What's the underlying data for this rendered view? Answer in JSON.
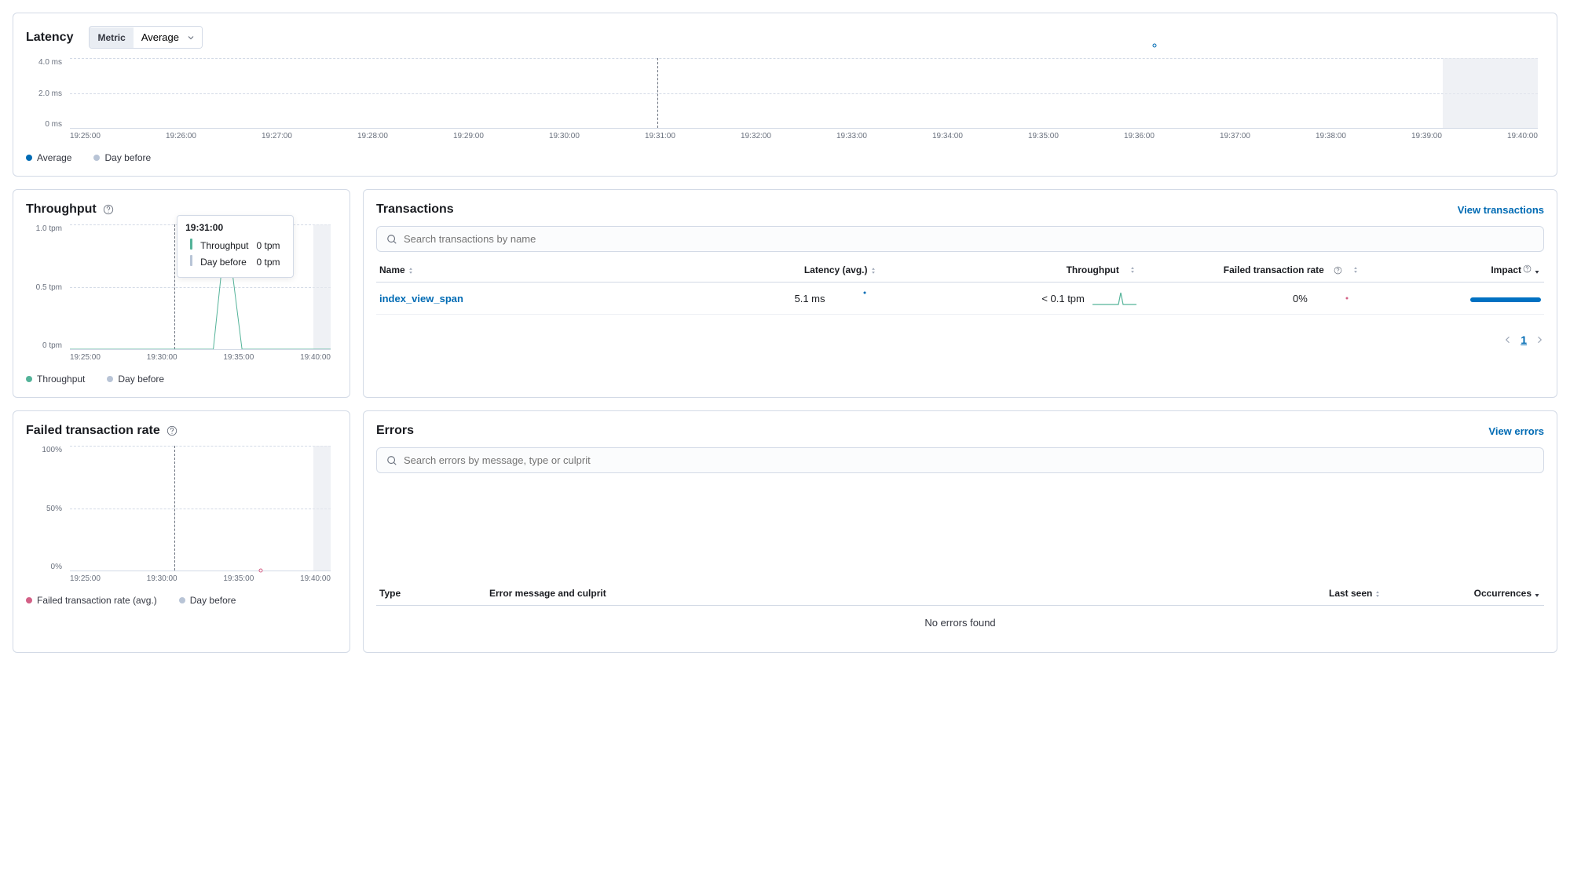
{
  "latency_panel": {
    "title": "Latency",
    "metric_label": "Metric",
    "metric_value": "Average",
    "y_ticks": [
      "4.0 ms",
      "2.0 ms",
      "0 ms"
    ],
    "x_ticks": [
      "19:25:00",
      "19:26:00",
      "19:27:00",
      "19:28:00",
      "19:29:00",
      "19:30:00",
      "19:31:00",
      "19:32:00",
      "19:33:00",
      "19:34:00",
      "19:35:00",
      "19:36:00",
      "19:37:00",
      "19:38:00",
      "19:39:00",
      "19:40:00"
    ],
    "legend": [
      {
        "label": "Average",
        "color": "#006bb4"
      },
      {
        "label": "Day before",
        "color": "#b8c4d6"
      }
    ],
    "data_point_x_pct": 73.9,
    "cursor_x_pct": 40.0,
    "ghost_start_pct": 93.5,
    "ghost_end_pct": 100
  },
  "throughput_panel": {
    "title": "Throughput",
    "y_ticks": [
      "1.0 tpm",
      "0.5 tpm",
      "0 tpm"
    ],
    "x_ticks": [
      "19:25:00",
      "19:30:00",
      "19:35:00",
      "19:40:00"
    ],
    "legend": [
      {
        "label": "Throughput",
        "color": "#54b399"
      },
      {
        "label": "Day before",
        "color": "#b8c4d6"
      }
    ],
    "cursor_x_pct": 40.0,
    "ghost_start_pct": 93.5,
    "tooltip": {
      "time": "19:31:00",
      "rows": [
        {
          "label": "Throughput",
          "value": "0 tpm",
          "color": "#54b399"
        },
        {
          "label": "Day before",
          "value": "0 tpm",
          "color": "#b8c4d6"
        }
      ]
    }
  },
  "failed_panel": {
    "title": "Failed transaction rate",
    "y_ticks": [
      "100%",
      "50%",
      "0%"
    ],
    "x_ticks": [
      "19:25:00",
      "19:30:00",
      "19:35:00",
      "19:40:00"
    ],
    "legend": [
      {
        "label": "Failed transaction rate (avg.)",
        "color": "#d36086"
      },
      {
        "label": "Day before",
        "color": "#b8c4d6"
      }
    ],
    "cursor_x_pct": 40.0,
    "ghost_start_pct": 93.5,
    "data_point_x_pct": 73.3
  },
  "transactions_panel": {
    "title": "Transactions",
    "view_link": "View transactions",
    "search_placeholder": "Search transactions by name",
    "columns": {
      "name": "Name",
      "latency": "Latency (avg.)",
      "throughput": "Throughput",
      "failed": "Failed transaction rate",
      "impact": "Impact"
    },
    "rows": [
      {
        "name": "index_view_span",
        "latency": "5.1 ms",
        "throughput": "< 0.1 tpm",
        "failed": "0%"
      }
    ],
    "page": "1"
  },
  "errors_panel": {
    "title": "Errors",
    "view_link": "View errors",
    "search_placeholder": "Search errors by message, type or culprit",
    "columns": {
      "type": "Type",
      "message": "Error message and culprit",
      "last_seen": "Last seen",
      "occurrences": "Occurrences"
    },
    "empty": "No errors found"
  },
  "chart_data": [
    {
      "type": "line",
      "title": "Latency",
      "ylabel": "ms",
      "ylim": [
        0,
        4.0
      ],
      "x": [
        "19:25:00",
        "19:26:00",
        "19:27:00",
        "19:28:00",
        "19:29:00",
        "19:30:00",
        "19:31:00",
        "19:32:00",
        "19:33:00",
        "19:34:00",
        "19:35:00",
        "19:36:00",
        "19:37:00",
        "19:38:00",
        "19:39:00",
        "19:40:00"
      ],
      "series": [
        {
          "name": "Average",
          "values": [
            null,
            null,
            null,
            null,
            null,
            null,
            null,
            null,
            null,
            null,
            null,
            5.1,
            null,
            null,
            null,
            null
          ]
        },
        {
          "name": "Day before",
          "values": [
            null,
            null,
            null,
            null,
            null,
            null,
            null,
            null,
            null,
            null,
            null,
            null,
            null,
            null,
            null,
            null
          ]
        }
      ]
    },
    {
      "type": "line",
      "title": "Throughput",
      "ylabel": "tpm",
      "ylim": [
        0,
        1.0
      ],
      "x": [
        "19:25:00",
        "19:26:00",
        "19:27:00",
        "19:28:00",
        "19:29:00",
        "19:30:00",
        "19:31:00",
        "19:32:00",
        "19:33:00",
        "19:34:00",
        "19:35:00",
        "19:36:00",
        "19:37:00",
        "19:38:00",
        "19:39:00",
        "19:40:00"
      ],
      "series": [
        {
          "name": "Throughput",
          "values": [
            0,
            0,
            0,
            0,
            0,
            0,
            0,
            0,
            0,
            1.0,
            0,
            0,
            0,
            0,
            0,
            0
          ]
        },
        {
          "name": "Day before",
          "values": [
            0,
            0,
            0,
            0,
            0,
            0,
            0,
            0,
            0,
            0,
            0,
            0,
            0,
            0,
            0,
            0
          ]
        }
      ]
    },
    {
      "type": "line",
      "title": "Failed transaction rate",
      "ylabel": "%",
      "ylim": [
        0,
        100
      ],
      "x": [
        "19:25:00",
        "19:26:00",
        "19:27:00",
        "19:28:00",
        "19:29:00",
        "19:30:00",
        "19:31:00",
        "19:32:00",
        "19:33:00",
        "19:34:00",
        "19:35:00",
        "19:36:00",
        "19:37:00",
        "19:38:00",
        "19:39:00",
        "19:40:00"
      ],
      "series": [
        {
          "name": "Failed transaction rate (avg.)",
          "values": [
            null,
            null,
            null,
            null,
            null,
            null,
            null,
            null,
            null,
            null,
            null,
            0,
            null,
            null,
            null,
            null
          ]
        },
        {
          "name": "Day before",
          "values": [
            null,
            null,
            null,
            null,
            null,
            null,
            null,
            null,
            null,
            null,
            null,
            null,
            null,
            null,
            null,
            null
          ]
        }
      ]
    }
  ]
}
